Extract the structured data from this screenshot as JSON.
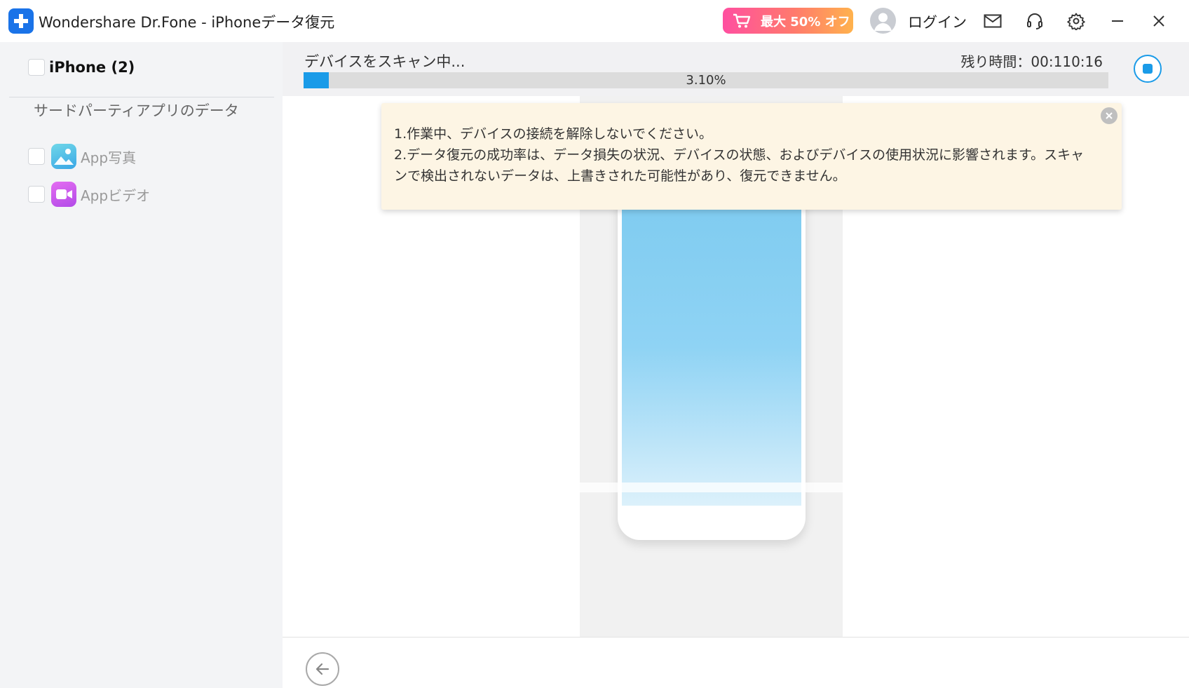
{
  "window": {
    "title": "Wondershare Dr.Fone - iPhoneデータ復元",
    "promo_label": "最大 50% オフ",
    "login_label": "ログイン",
    "icons": [
      "mail-icon",
      "headset-icon",
      "gear-icon",
      "minimize-icon",
      "close-icon"
    ]
  },
  "sidebar": {
    "device_label": "iPhone (2)",
    "section_title": "サードパーティアプリのデータ",
    "items": [
      {
        "label": "App写真",
        "icon": "photos-app-icon",
        "checked": false
      },
      {
        "label": "Appビデオ",
        "icon": "video-app-icon",
        "checked": false
      }
    ]
  },
  "scan": {
    "title": "デバイスをスキャン中...",
    "remaining": "残り時間：00:110:16",
    "progress_text": "3.10%",
    "progress_value": 0.031
  },
  "tip": {
    "line1": "1.作業中、デバイスの接続を解除しないでください。",
    "line2": "2.データ復元の成功率は、データ損失の状況、デバイスの状態、およびデバイスの使用状況に影響されます。スキャ",
    "line3": "ンで検出されないデータは、上書きされた可能性があり、復元できません。"
  },
  "colors": {
    "accent": "#1a9be8",
    "tip_background": "#fdf5e4",
    "sidebar_background": "#f3f4f6"
  }
}
